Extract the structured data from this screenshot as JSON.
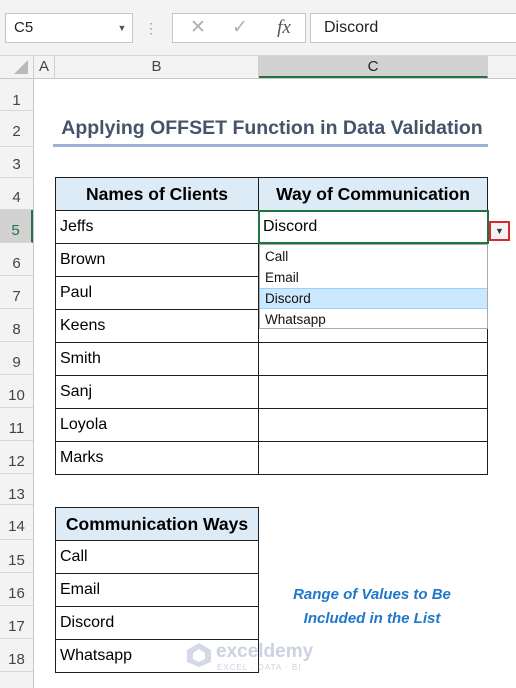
{
  "formula_bar": {
    "name_box": "C5",
    "cancel_glyph": "✕",
    "enter_glyph": "✓",
    "fx_glyph": "fx",
    "content": "Discord"
  },
  "columns": [
    "A",
    "B",
    "C"
  ],
  "rows": [
    "1",
    "2",
    "3",
    "4",
    "5",
    "6",
    "7",
    "8",
    "9",
    "10",
    "11",
    "12",
    "13",
    "14",
    "15",
    "16",
    "17",
    "18"
  ],
  "title": "Applying OFFSET Function in Data Validation",
  "main_table": {
    "headers": [
      "Names of Clients",
      "Way of Communication"
    ],
    "rows": [
      [
        "Jeffs",
        "Discord"
      ],
      [
        "Brown",
        ""
      ],
      [
        "Paul",
        ""
      ],
      [
        "Keens",
        ""
      ],
      [
        "Smith",
        ""
      ],
      [
        "Sanj",
        ""
      ],
      [
        "Loyola",
        ""
      ],
      [
        "Marks",
        ""
      ]
    ]
  },
  "dropdown": {
    "options": [
      "Call",
      "Email",
      "Discord",
      "Whatsapp"
    ],
    "selected": "Discord"
  },
  "ways_table": {
    "header": "Communication Ways",
    "values": [
      "Call",
      "Email",
      "Discord",
      "Whatsapp"
    ]
  },
  "note": [
    "Range of Values to Be",
    "Included in the List"
  ],
  "watermark": {
    "name": "exceldemy",
    "sub": "EXCEL · DATA · BI"
  },
  "colors": {
    "header_fill": "#ddebf7",
    "title": "#44546a",
    "note": "#1f78c9",
    "active_border": "#217346",
    "highlight": "#e0242b"
  }
}
